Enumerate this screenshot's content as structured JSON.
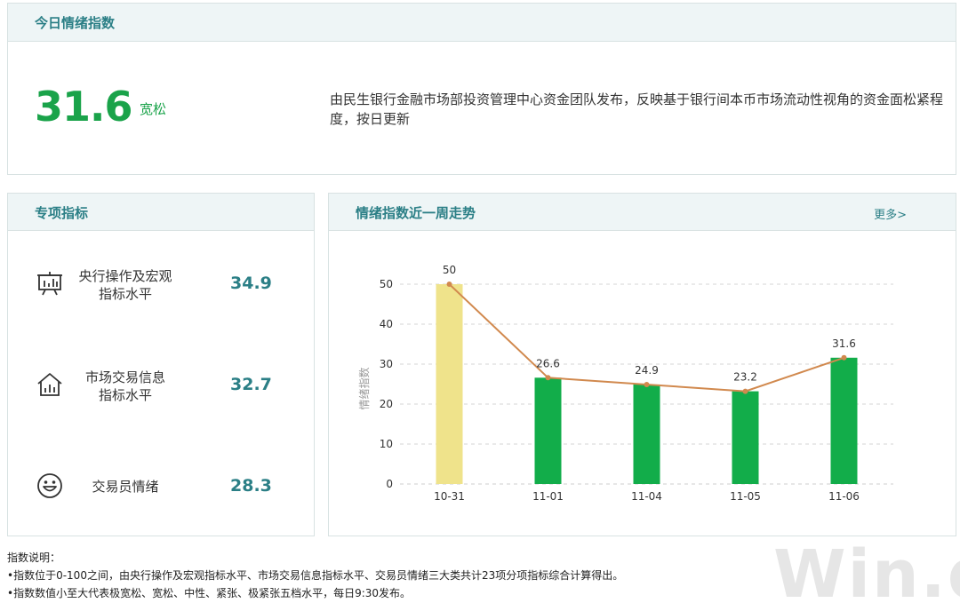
{
  "today": {
    "title": "今日情绪指数",
    "value": "31.6",
    "status": "宽松",
    "description": "由民生银行金融市场部投资管理中心资金团队发布，反映基于银行间本币市场流动性视角的资金面松紧程度，按日更新"
  },
  "special": {
    "title": "专项指标",
    "items": [
      {
        "label_line1": "央行操作及宏观",
        "label_line2": "指标水平",
        "value": "34.9",
        "icon": "chart-board-icon"
      },
      {
        "label_line1": "市场交易信息",
        "label_line2": "指标水平",
        "value": "32.7",
        "icon": "house-chart-icon"
      },
      {
        "label_line1": "交易员情绪",
        "label_line2": "",
        "value": "28.3",
        "icon": "smiley-icon"
      }
    ]
  },
  "trend": {
    "title": "情绪指数近一周走势",
    "more": "更多>"
  },
  "chart_data": {
    "type": "bar",
    "categories": [
      "10-31",
      "11-01",
      "11-04",
      "11-05",
      "11-06"
    ],
    "values": [
      50,
      26.6,
      24.9,
      23.2,
      31.6
    ],
    "data_labels": [
      "50",
      "26.6",
      "24.9",
      "23.2",
      "31.6"
    ],
    "bar_colors": [
      "#efe38b",
      "#12ad4a",
      "#12ad4a",
      "#12ad4a",
      "#12ad4a"
    ],
    "line_color": "#d1894e",
    "ylabel": "情绪指数",
    "ylim": [
      0,
      50
    ],
    "yticks": [
      0,
      10,
      20,
      30,
      40,
      50
    ],
    "grid": true,
    "overlay_line": true
  },
  "notes": {
    "title": "指数说明：",
    "line1": "•指数位于0-100之间，由央行操作及宏观指标水平、市场交易信息指标水平、交易员情绪三大类共计23项分项指标综合计算得出。",
    "line2": "•指数数值小至大代表极宽松、宽松、中性、紧张、极紧张五档水平，每日9:30发布。"
  },
  "watermark": "Win.d"
}
